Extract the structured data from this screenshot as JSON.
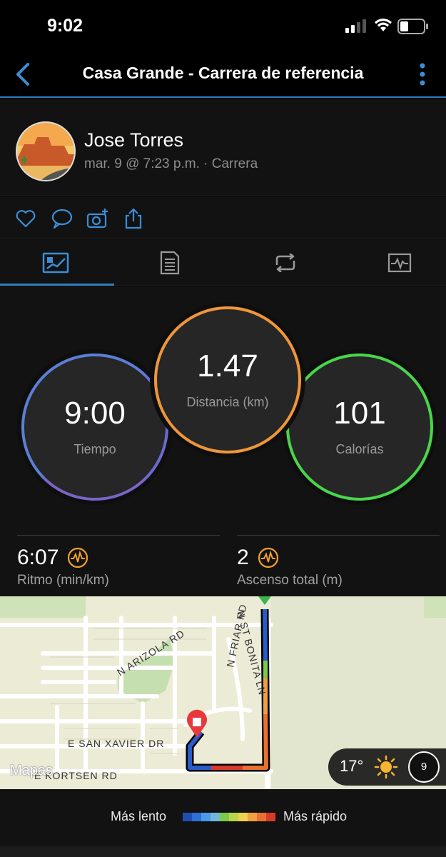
{
  "status_bar": {
    "time": "9:02"
  },
  "nav": {
    "title": "Casa Grande - Carrera de referencia"
  },
  "profile": {
    "name": "Jose Torres",
    "meta": "mar. 9 @ 7:23 p.m. · Carrera"
  },
  "summary": {
    "tiempo": {
      "value": "9:00",
      "label": "Tiempo"
    },
    "distancia": {
      "value": "1.47",
      "label": "Distancia (km)"
    },
    "calorias": {
      "value": "101",
      "label": "Calorías"
    },
    "ritmo": {
      "value": "6:07",
      "label": "Ritmo (min/km)"
    },
    "ascenso": {
      "value": "2",
      "label": "Ascenso total (m)"
    }
  },
  "map": {
    "streets": [
      "N ARIZOLA RD",
      "N ST BONITA LN",
      "N FRIAR RD",
      "E SAN XAVIER DR",
      "E KORTSEN RD"
    ],
    "attribution": "Mapas",
    "weather": {
      "temp": "17°",
      "wind": "9"
    }
  },
  "legend": {
    "slow": "Más lento",
    "fast": "Más rápido",
    "colors": [
      "#1f4fb0",
      "#2f6fd8",
      "#4a9ae8",
      "#6fb8d8",
      "#7ec84a",
      "#b8d64a",
      "#f0d050",
      "#f0a040",
      "#e87030",
      "#d83a2a"
    ]
  },
  "colors": {
    "accent": "#2f7fc0",
    "tiempo": "#5b7fd7",
    "distancia": "#f0963a",
    "calorias": "#49d64a",
    "stat_icon": "#f0a030"
  },
  "icons": [
    "back-chevron-icon",
    "more-vertical-icon",
    "heart-icon",
    "comment-icon",
    "add-photo-icon",
    "share-icon",
    "overview-tab-icon",
    "details-tab-icon",
    "laps-tab-icon",
    "charts-tab-icon",
    "performance-icon",
    "sun-icon",
    "apple-icon",
    "finish-marker-icon"
  ]
}
